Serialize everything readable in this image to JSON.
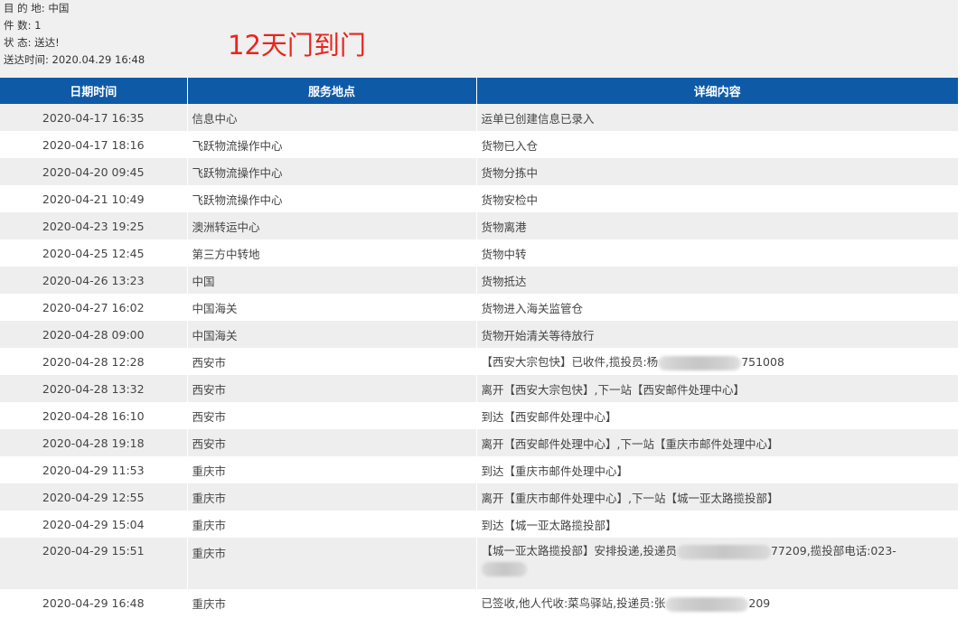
{
  "summary": {
    "destination": "目 的 地:  中国",
    "pieces": "件 数:  1",
    "status": "状 态:  送达!",
    "delivered_time": "送达时间:  2020.04.29 16:48"
  },
  "annotation": "12天门到门",
  "table": {
    "headers": [
      "日期时间",
      "服务地点",
      "详细内容"
    ],
    "rows": [
      {
        "time": "2020-04-17 16:35",
        "location": "信息中心",
        "detail": "运单已创建信息已录入"
      },
      {
        "time": "2020-04-17 18:16",
        "location": "飞跃物流操作中心",
        "detail": "货物已入仓"
      },
      {
        "time": "2020-04-20 09:45",
        "location": "飞跃物流操作中心",
        "detail": "货物分拣中"
      },
      {
        "time": "2020-04-21 10:49",
        "location": "飞跃物流操作中心",
        "detail": "货物安检中"
      },
      {
        "time": "2020-04-23 19:25",
        "location": "澳洲转运中心",
        "detail": "货物离港"
      },
      {
        "time": "2020-04-25 12:45",
        "location": "第三方中转地",
        "detail": "货物中转"
      },
      {
        "time": "2020-04-26 13:23",
        "location": "中国",
        "detail": "货物抵达"
      },
      {
        "time": "2020-04-27 16:02",
        "location": "中国海关",
        "detail": "货物进入海关监管仓"
      },
      {
        "time": "2020-04-28 09:00",
        "location": "中国海关",
        "detail": "货物开始清关等待放行"
      },
      {
        "time": "2020-04-28 12:28",
        "location": "西安市",
        "detail_a": "【西安大宗包快】已收件,揽投员:杨",
        "detail_b": "751008"
      },
      {
        "time": "2020-04-28 13:32",
        "location": "西安市",
        "detail": "离开【西安大宗包快】,下一站【西安邮件处理中心】"
      },
      {
        "time": "2020-04-28 16:10",
        "location": "西安市",
        "detail": "到达【西安邮件处理中心】"
      },
      {
        "time": "2020-04-28 19:18",
        "location": "西安市",
        "detail": "离开【西安邮件处理中心】,下一站【重庆市邮件处理中心】"
      },
      {
        "time": "2020-04-29 11:53",
        "location": "重庆市",
        "detail": "到达【重庆市邮件处理中心】"
      },
      {
        "time": "2020-04-29 12:55",
        "location": "重庆市",
        "detail": "离开【重庆市邮件处理中心】,下一站【城一亚太路揽投部】"
      },
      {
        "time": "2020-04-29 15:04",
        "location": "重庆市",
        "detail": "到达【城一亚太路揽投部】"
      },
      {
        "time": "2020-04-29 15:51",
        "location": "重庆市",
        "detail_a": "【城一亚太路揽投部】安排投递,投递员",
        "detail_b": "77209,揽投部电话:023-"
      },
      {
        "time": "2020-04-29 16:48",
        "location": "重庆市",
        "detail_a": "已签收,他人代收:菜鸟驿站,投递员:张",
        "detail_b": "209"
      }
    ]
  }
}
